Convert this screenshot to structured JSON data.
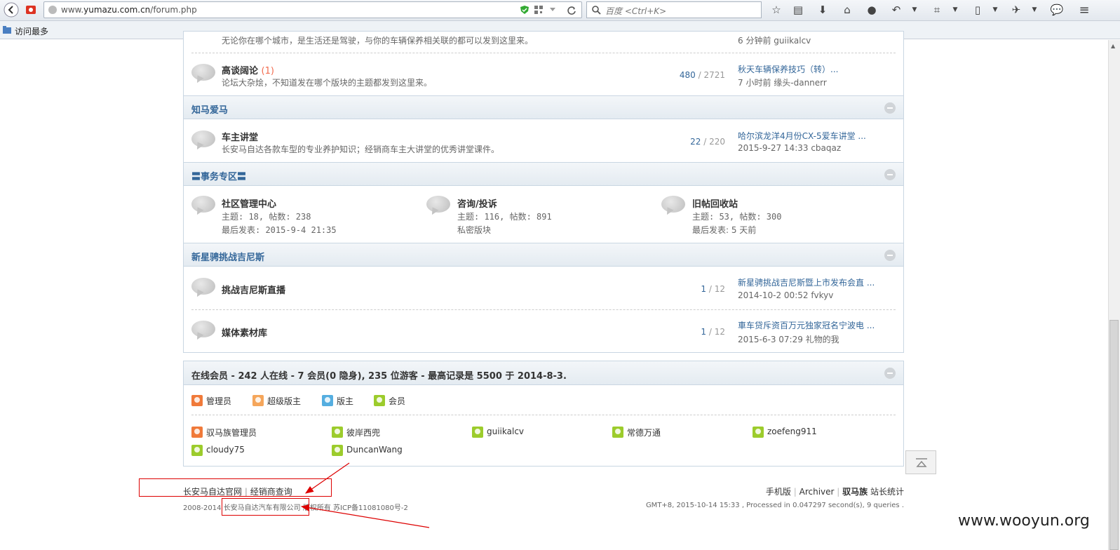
{
  "browser": {
    "url_prefix": "www.",
    "url_domain": "yumazu.com.cn",
    "url_path": "/forum.php",
    "search_placeholder": "百度 <Ctrl+K>",
    "bookmark_label": "访问最多"
  },
  "forums_top": {
    "partial_row_text": "无论你在哪个城市，是生活还是驾驶，与你的车辆保养相关联的都可以发到这里来。",
    "partial_row_last": "6 分钟前 guiikalcv",
    "chat": {
      "name": "高谈阔论",
      "count": "(1)",
      "desc": "论坛大杂烩，不知道发在哪个版块的主题都发到这里来。",
      "threads": "480",
      "posts": "2721",
      "last_title": "秋天车辆保养技巧（转）...",
      "last_meta": "7 小时前 缘头-dannerr"
    }
  },
  "categories": [
    {
      "title": "知马爱马",
      "forums": [
        {
          "name": "车主讲堂",
          "desc": "长安马自达各款车型的专业养护知识；经销商车主大讲堂的优秀讲堂课件。",
          "threads": "22",
          "posts": "220",
          "last_title": "哈尔滨龙洋4月份CX-5爱车讲堂 ...",
          "last_meta": "2015-9-27 14:33 cbaqaz"
        }
      ]
    },
    {
      "title": "〓事务专区〓",
      "grid": [
        {
          "name": "社区管理中心",
          "line1": "主题: 18, 帖数: 238",
          "line2": "最后发表: 2015-9-4 21:35"
        },
        {
          "name": "咨询/投诉",
          "line1": "主题: 116, 帖数: 891",
          "line2": "私密版块"
        },
        {
          "name": "旧帖回收站",
          "line1": "主题: 53, 帖数: 300",
          "line2": "最后发表: 5 天前"
        }
      ]
    },
    {
      "title": "新星骋挑战吉尼斯",
      "forums": [
        {
          "name": "挑战吉尼斯直播",
          "threads": "1",
          "posts": "12",
          "last_title": "新星骋挑战吉尼斯暨上市发布会直 ...",
          "last_meta": "2014-10-2 00:52 fvkyv"
        },
        {
          "name": "媒体素材库",
          "threads": "1",
          "posts": "12",
          "last_title": "車车贷斥资百万元独家冠名宁波电 ...",
          "last_meta": "2015-6-3 07:29 礼物的我"
        }
      ]
    }
  ],
  "online": {
    "title": "在线会员 - 242 人在线 - 7 会员(0 隐身), 235 位游客 - 最高记录是 5500 于 2014-8-3.",
    "legend": [
      {
        "label": "管理员",
        "color": "#f07a3a"
      },
      {
        "label": "超级版主",
        "color": "#f5a65b"
      },
      {
        "label": "版主",
        "color": "#55aee0"
      },
      {
        "label": "会员",
        "color": "#9ccc2c"
      }
    ],
    "members": [
      {
        "name": "驭马族管理员",
        "color": "#f07a3a"
      },
      {
        "name": "彼岸西兜",
        "color": "#9ccc2c"
      },
      {
        "name": "guiikalcv",
        "color": "#9ccc2c"
      },
      {
        "name": "常德万通",
        "color": "#9ccc2c"
      },
      {
        "name": "zoefeng911",
        "color": "#9ccc2c"
      },
      {
        "name": "cloudy75",
        "color": "#9ccc2c"
      },
      {
        "name": "DuncanWang",
        "color": "#9ccc2c"
      }
    ]
  },
  "footer": {
    "link_official": "长安马自达官网",
    "link_dealer": "经销商查询",
    "copyright": "2008-2014 长安马自达汽车有限公司 版权所有 苏ICP备11081080号-2",
    "mobile": "手机版",
    "archiver": "Archiver",
    "brand": "驭马族",
    "stats": "站长统计",
    "meta": "GMT+8, 2015-10-14 15:33 , Processed in 0.047297 second(s), 9 queries ."
  },
  "watermark": "www.wooyun.org"
}
